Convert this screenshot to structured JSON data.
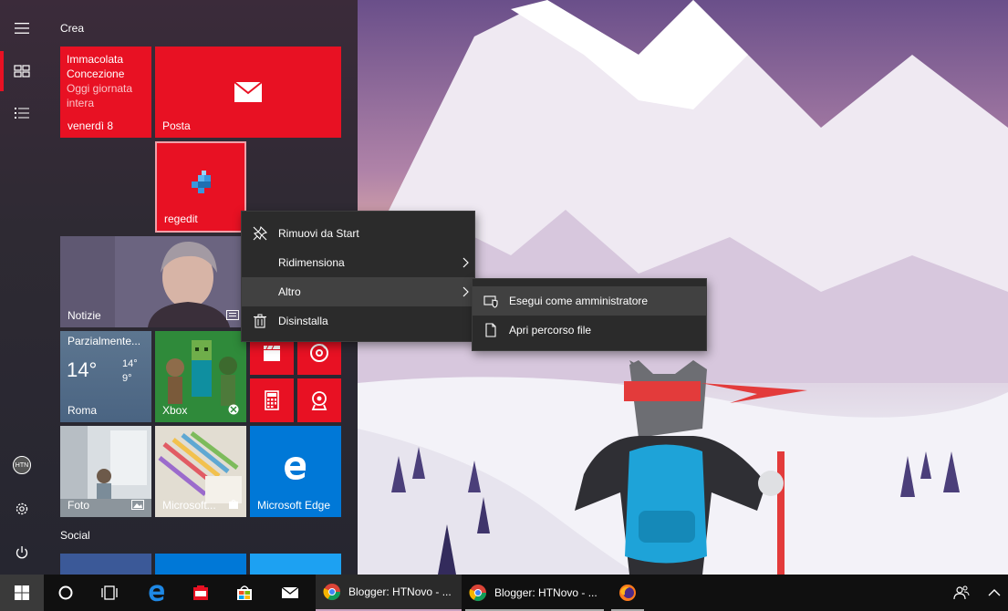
{
  "start_menu": {
    "group_crea": "Crea",
    "group_social": "Social",
    "tiles": {
      "calendar": {
        "line1": "Immacolata",
        "line2": "Concezione",
        "line3": "Oggi giornata",
        "line4": "intera",
        "date": "venerdì 8"
      },
      "mail": {
        "label": "Posta"
      },
      "regedit": {
        "label": "regedit"
      },
      "news": {
        "label": "Notizie"
      },
      "weather": {
        "condition": "Parzialmente...",
        "temp": "14°",
        "high": "14°",
        "low": "9°",
        "city": "Roma"
      },
      "xbox": {
        "label": "Xbox"
      },
      "photos": {
        "label": "Foto"
      },
      "store": {
        "label": "Microsoft..."
      },
      "edge": {
        "label": "Microsoft Edge"
      }
    },
    "rail": {
      "avatar": "HTN"
    }
  },
  "context_menu": {
    "items": [
      {
        "label": "Rimuovi da Start",
        "icon": "unpin-icon"
      },
      {
        "label": "Ridimensiona",
        "icon": "none",
        "submenu": true
      },
      {
        "label": "Altro",
        "icon": "none",
        "submenu": true,
        "hover": true
      },
      {
        "label": "Disinstalla",
        "icon": "trash-icon"
      }
    ]
  },
  "submenu": {
    "items": [
      {
        "label": "Esegui come amministratore",
        "icon": "admin-shield-icon",
        "hover": true
      },
      {
        "label": "Apri percorso file",
        "icon": "file-icon"
      }
    ]
  },
  "taskbar": {
    "apps": [
      {
        "label": "Blogger: HTNovo - ...",
        "icon": "chrome-icon",
        "active": true
      },
      {
        "label": "Blogger: HTNovo - ...",
        "icon": "chrome-icon",
        "active": false
      }
    ]
  },
  "colors": {
    "accent": "#e81123",
    "edge_blue": "#0078d7",
    "menu_bg": "#2b2b2b"
  }
}
